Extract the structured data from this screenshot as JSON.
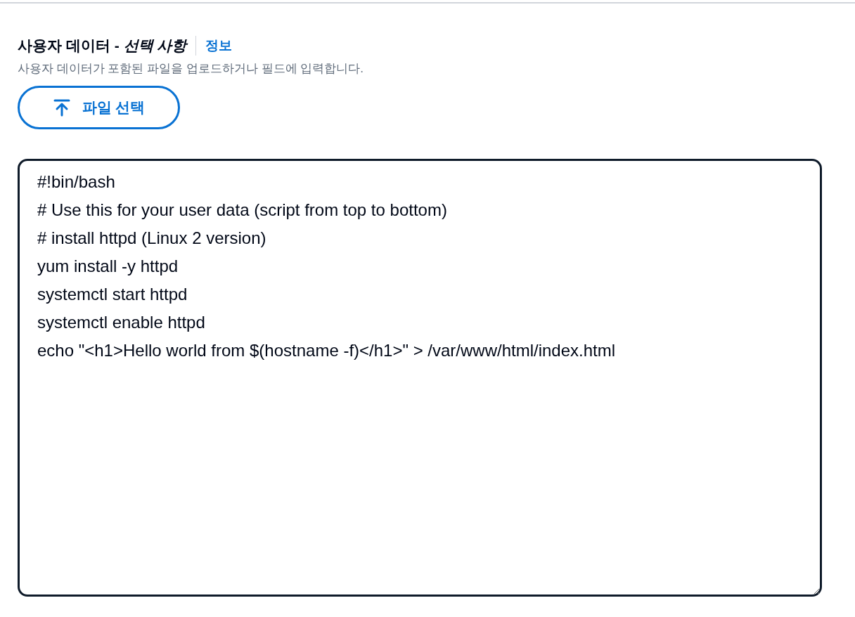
{
  "field": {
    "label": "사용자 데이터 - *선택 사항*",
    "info_link": "정보",
    "description": "사용자 데이터가 포함된 파일을 업로드하거나 필드에 입력합니다.",
    "file_button": "파일 선택",
    "value": "#!bin/bash\n# Use this for your user data (script from top to bottom)\n# install httpd (Linux 2 version)\nyum install -y httpd\nsystemctl start httpd\nsystemctl enable httpd\necho \"<h1>Hello world from $(hostname -f)</h1>\" > /var/www/html/index.html"
  }
}
